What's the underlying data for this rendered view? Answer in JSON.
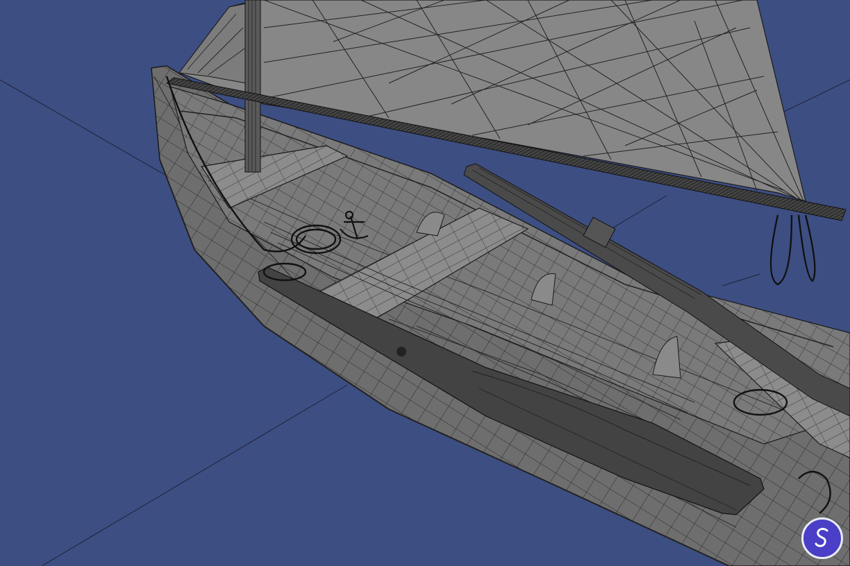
{
  "viewport": {
    "background_color": "#3d4e82",
    "axis_line_color": "#1c2238",
    "wire_color": "#1a1a1a",
    "hull_color": "#6e6e6e",
    "hull_shadow_color": "#4a4a4a",
    "interior_color": "#7c7c7c",
    "deck_color": "#8a8a8a",
    "sail_color": "#868686",
    "spar_color": "#3a3a3a"
  },
  "badge": {
    "icon": "app-logo-icon",
    "color": "#4a3fc6",
    "ring_color": "#e9ecf7"
  }
}
